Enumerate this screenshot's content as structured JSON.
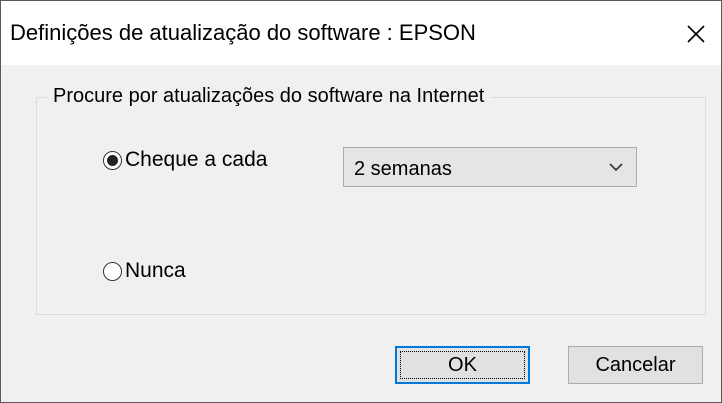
{
  "window": {
    "title": "Definições de atualização do software : EPSON",
    "close_icon": "close-icon"
  },
  "group": {
    "legend": "Procure por atualizações do software na Internet"
  },
  "options": {
    "check_every_label": "Cheque a cada",
    "check_every_selected": true,
    "never_label": "Nunca",
    "never_selected": false
  },
  "interval_select": {
    "value": "2 semanas"
  },
  "buttons": {
    "ok_label": "OK",
    "cancel_label": "Cancelar"
  },
  "colors": {
    "focus_border": "#0078d7",
    "dialog_bg": "#f0f0f0"
  }
}
